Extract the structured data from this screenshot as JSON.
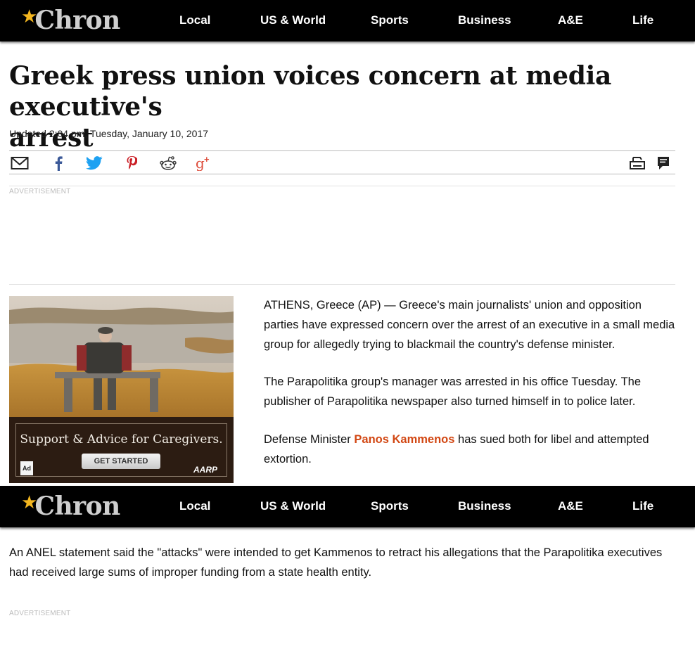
{
  "brand": {
    "name": "Chron",
    "star": "★",
    "star_color": "#f3b61f"
  },
  "nav": {
    "items": [
      {
        "label": "Local"
      },
      {
        "label": "US & World"
      },
      {
        "label": "Sports"
      },
      {
        "label": "Business"
      },
      {
        "label": "A&E"
      },
      {
        "label": "Life"
      }
    ]
  },
  "article": {
    "headline_line1": "Greek press union voices concern at media executive's",
    "headline_line2": "arrest",
    "updated": "Updated 2:04 pm, Tuesday, January 10, 2017",
    "p1": "ATHENS, Greece (AP) — Greece's main journalists' union and opposition parties have expressed concern over the arrest of an executive in a small media group for allegedly trying to blackmail the country's defense minister.",
    "p2": "The Parapolitika group's manager was arrested in his office Tuesday. The publisher of Parapolitika newspaper also turned himself in to police later.",
    "p3_before": "Defense Minister ",
    "p3_link": "Panos Kammenos",
    "p3_after": " has sued both for libel and attempted extortion.",
    "p4": "An ANEL statement said the \"attacks\" were intended to get Kammenos to retract his allegations that the Parapolitika executives had received large sums of improper funding from a state health entity."
  },
  "share": {
    "icons": [
      "email-icon",
      "facebook-icon",
      "twitter-icon",
      "pinterest-icon",
      "reddit-icon",
      "google-plus-icon"
    ],
    "right_icons": [
      "print-icon",
      "comments-icon"
    ],
    "colors": {
      "facebook": "#3b5998",
      "twitter": "#1da1f2",
      "pinterest": "#cb2027",
      "google_plus": "#dd4b39"
    }
  },
  "ads": {
    "label": "ADVERTISEMENT",
    "tagline": "Support & Advice for Caregivers.",
    "cta": "GET STARTED",
    "ad_mark": "Ad",
    "sponsor": "AARP"
  },
  "link_color": "#d24713"
}
